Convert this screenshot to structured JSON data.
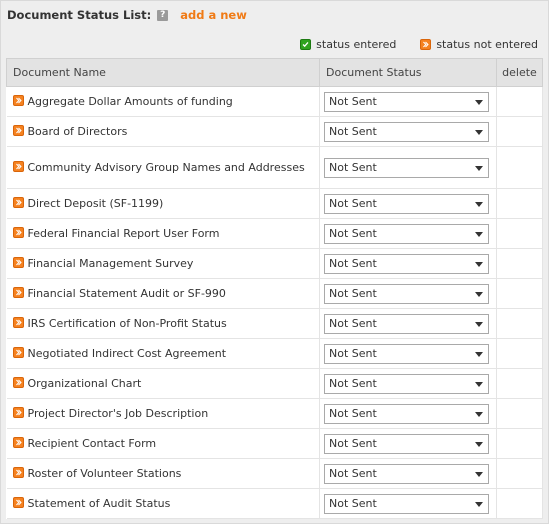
{
  "header": {
    "title": "Document Status List:",
    "help_icon": "question-mark-icon",
    "add_link": "add a new"
  },
  "legend": {
    "entered_label": "status entered",
    "not_entered_label": "status not entered",
    "entered_color": "#2fa31f",
    "not_entered_color": "#f58220"
  },
  "table": {
    "headers": {
      "name": "Document Name",
      "status": "Document Status",
      "delete": "delete"
    },
    "rows": [
      {
        "name": "Aggregate Dollar Amounts of funding",
        "status": "Not Sent"
      },
      {
        "name": "Board of Directors",
        "status": "Not Sent"
      },
      {
        "name": "Community Advisory Group Names and Addresses",
        "status": "Not Sent"
      },
      {
        "name": "Direct Deposit (SF-1199)",
        "status": "Not Sent"
      },
      {
        "name": "Federal Financial Report User Form",
        "status": "Not Sent"
      },
      {
        "name": "Financial Management Survey",
        "status": "Not Sent"
      },
      {
        "name": "Financial Statement Audit or SF-990",
        "status": "Not Sent"
      },
      {
        "name": "IRS Certification of Non-Profit Status",
        "status": "Not Sent"
      },
      {
        "name": "Negotiated Indirect Cost Agreement",
        "status": "Not Sent"
      },
      {
        "name": "Organizational Chart",
        "status": "Not Sent"
      },
      {
        "name": "Project Director's Job Description",
        "status": "Not Sent"
      },
      {
        "name": "Recipient Contact Form",
        "status": "Not Sent"
      },
      {
        "name": "Roster of Volunteer Stations",
        "status": "Not Sent"
      },
      {
        "name": "Statement of Audit Status",
        "status": "Not Sent"
      }
    ]
  }
}
